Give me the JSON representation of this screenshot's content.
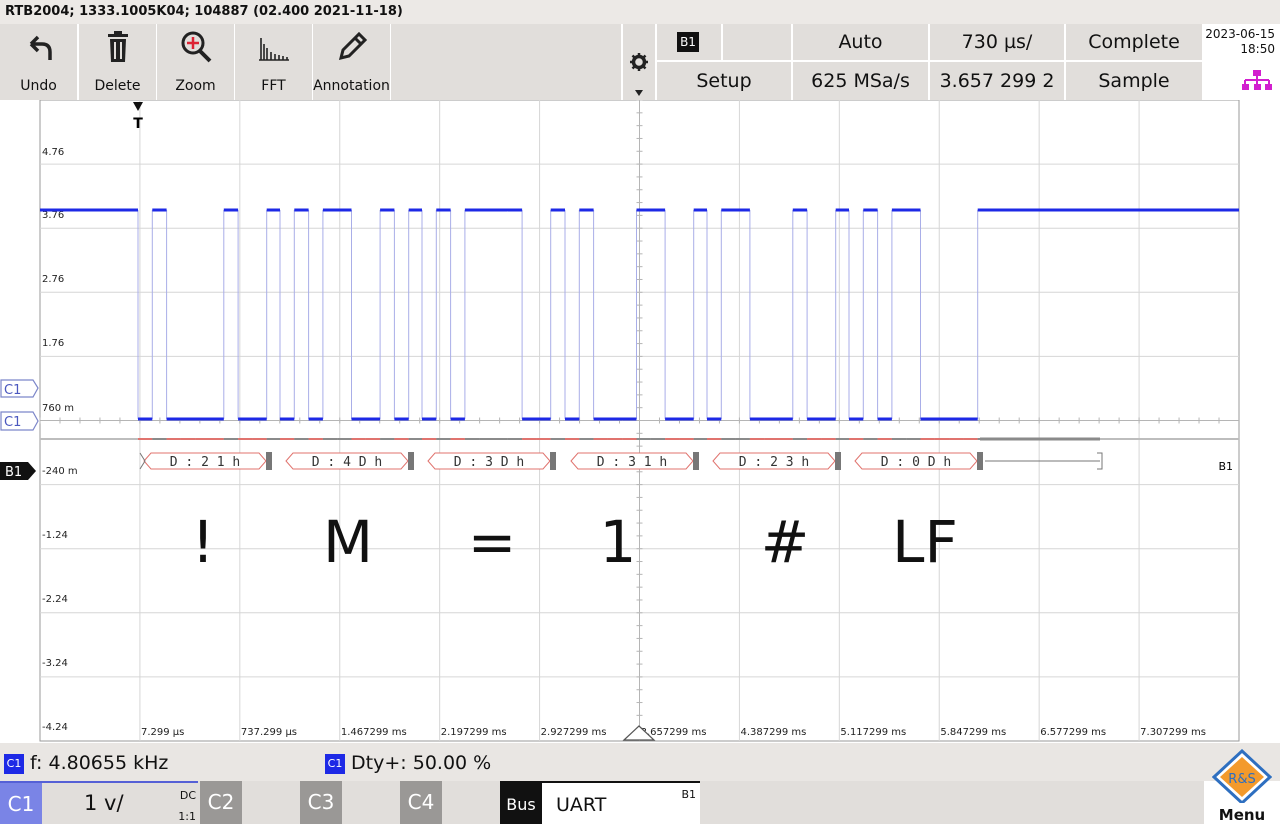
{
  "title_bar": {
    "text": "RTB2004; 1333.1005K04; 104887 (02.400 2021-11-18)"
  },
  "toolbar": {
    "undo": "Undo",
    "delete": "Delete",
    "zoom": "Zoom",
    "fft": "FFT",
    "annotation": "Annotation"
  },
  "settings": {
    "bus_tag": "B1",
    "trigger_mode": "Auto",
    "time_scale": "730 µs/",
    "acq_status": "Complete",
    "setup": "Setup",
    "sample_rate": "625 MSa/s",
    "time_offset": "3.657 299 2 ms",
    "acq_mode": "Sample"
  },
  "datetime": {
    "date": "2023-06-15",
    "time": "18:50"
  },
  "scope": {
    "trigger_marker": "T",
    "y_labels": [
      "4.76",
      "3.76",
      "2.76",
      "1.76",
      "760 m",
      "-240 m",
      "-1.24",
      "-2.24",
      "-3.24",
      "-4.24"
    ],
    "x_labels": [
      "7.299 µs",
      "737.299 µs",
      "1.467299 ms",
      "2.197299 ms",
      "2.927299 ms",
      "3.657299 ms",
      "4.387299 ms",
      "5.117299 ms",
      "5.847299 ms",
      "6.577299 ms",
      "7.307299 ms"
    ],
    "ch_trigger_tag": "C1",
    "ch_tag": "C1",
    "bus_tag": "B1",
    "bus_end_tag": "B1",
    "decode_frames": [
      "D : 2 1 h",
      "D : 4 D h",
      "D : 3 D h",
      "D : 3 1 h",
      "D : 2 3 h",
      "D : 0 D h"
    ],
    "annotations": [
      "!",
      "M",
      "=",
      "1",
      "#",
      "LF"
    ]
  },
  "measurements": {
    "freq_tag": "C1",
    "freq": "f: 4.80655 kHz",
    "duty_tag": "C1",
    "duty": "Dty+: 50.00 %"
  },
  "channels": {
    "c1": "C1",
    "c1_scale": "1 v/",
    "c1_coupling": "DC",
    "c1_probe": "1:1",
    "c2": "C2",
    "c3": "C3",
    "c4": "C4",
    "bus": "Bus",
    "bus_proto": "UART",
    "bus_id": "B1",
    "menu": "Menu",
    "logo": "R&S"
  },
  "colors": {
    "trace": "#1d29e6",
    "decode": "#e0736e",
    "grid": "#cfcfcf",
    "toolbar": "#e1dedb"
  }
}
